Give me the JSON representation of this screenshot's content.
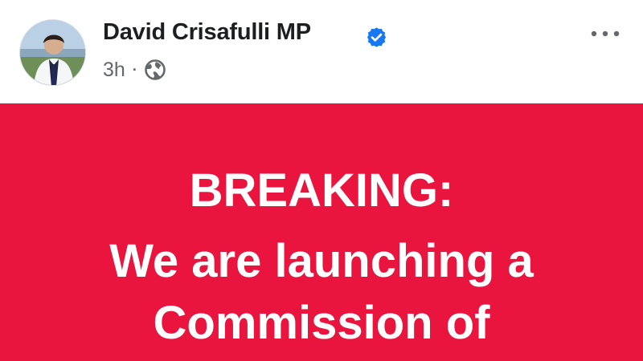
{
  "post": {
    "author": {
      "name": "David Crisafulli MP",
      "verified": true,
      "avatar_icon": "profile-photo-avatar"
    },
    "meta": {
      "time": "3h",
      "separator": "·",
      "audience_icon": "globe-icon"
    },
    "menu_icon": "more-horizontal-icon",
    "media": {
      "background_color": "#e9153f",
      "text_color": "#ffffff",
      "lines": [
        "BREAKING:",
        "We are launching a",
        "Commission of"
      ]
    }
  },
  "colors": {
    "verified_blue": "#1877f2",
    "secondary_text": "#65676b",
    "primary_text": "#1c1e21"
  }
}
